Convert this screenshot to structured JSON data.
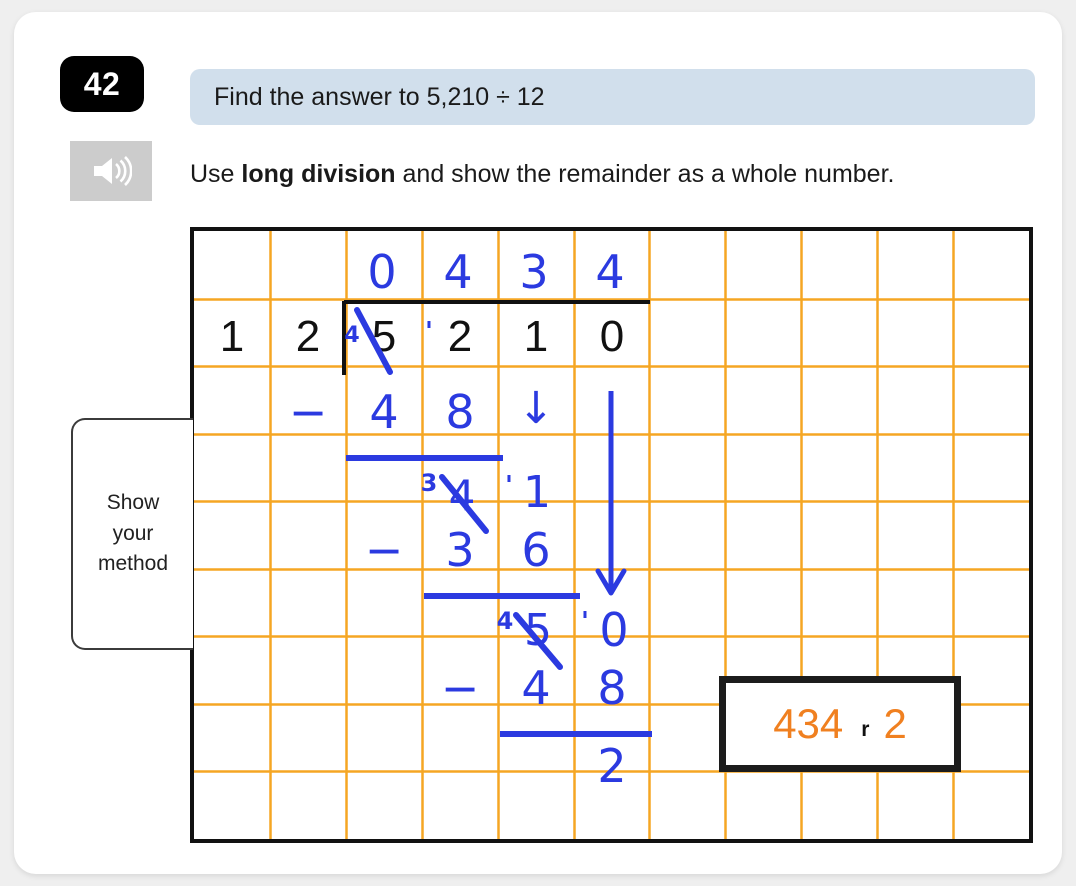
{
  "question": {
    "number": "42",
    "banner_text": "Find the answer to 5,210 ÷ 12",
    "instruction_prefix": "Use ",
    "instruction_bold": "long division",
    "instruction_suffix": " and show the remainder as a whole number.",
    "speaker_icon": "speaker-icon"
  },
  "method_tab": {
    "label": "Show\nyour\nmethod"
  },
  "grid": {
    "columns": 11,
    "rows": 9,
    "line_color": "#f5a623",
    "border_color": "#111111"
  },
  "work": {
    "quotient": [
      "0",
      "4",
      "3",
      "4"
    ],
    "divisor": [
      "1",
      "2"
    ],
    "dividend": [
      "5",
      "2",
      "1",
      "0"
    ],
    "carry_marks": [
      "4",
      "'",
      "",
      ""
    ],
    "step1_minus": "−",
    "step1_digits": [
      "4",
      "8"
    ],
    "step1_arrow": "↓",
    "rem1_super": "3",
    "rem1_digits": [
      "4",
      "1"
    ],
    "rem1_tick": "'",
    "step2_minus": "−",
    "step2_digits": [
      "3",
      "6"
    ],
    "step2_arrow": "↓",
    "rem2_super": "4",
    "rem2_digits": [
      "5",
      "0"
    ],
    "rem2_tick": "'",
    "step3_minus": "−",
    "step3_digits": [
      "4",
      "8"
    ],
    "final_remainder": "2"
  },
  "answer": {
    "quotient": "434",
    "r_label": "r",
    "remainder": "2",
    "text_color": "#f08020"
  }
}
